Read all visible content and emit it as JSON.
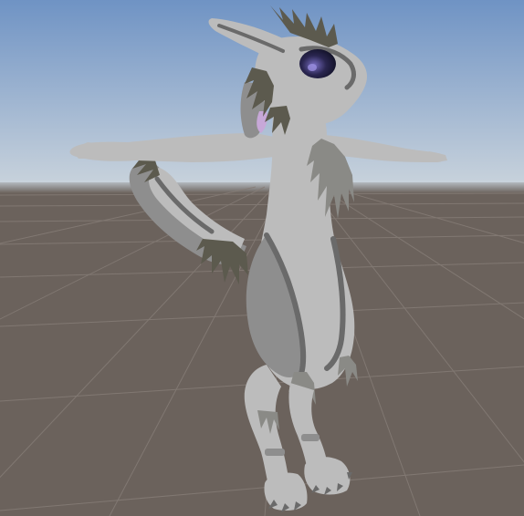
{
  "viewport": {
    "sky_top_color": "#6f93c4",
    "sky_horizon_color": "#c9d3dc",
    "ground_color": "#6b625c",
    "grid_line_color": "#857c76"
  },
  "model": {
    "pose": "T-pose",
    "body_color": "#bcbcbc",
    "shade_color": "#8e8e8e",
    "stripe_color": "#6a6a6a",
    "eye_color": "#1a1832",
    "eye_highlight_color": "#7a6fc4",
    "inner_ear_color": "#c7a8d8",
    "fur_color": "#8a8a86",
    "fur_dark_color": "#5c5a4e"
  }
}
